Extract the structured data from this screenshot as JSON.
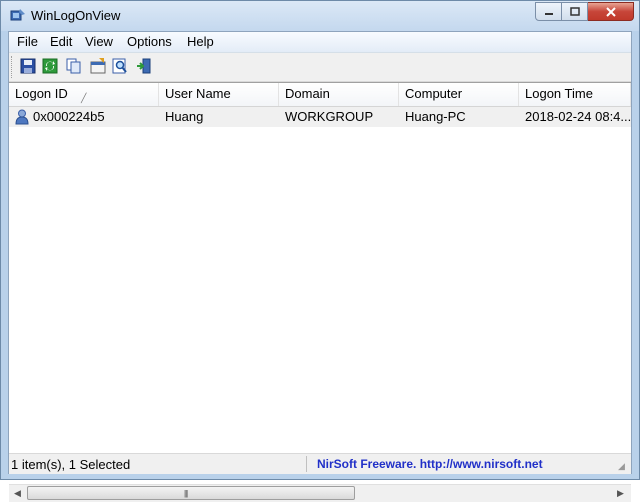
{
  "window": {
    "title": "WinLogOnView"
  },
  "menu": [
    "File",
    "Edit",
    "View",
    "Options",
    "Help"
  ],
  "toolbar": {
    "icons": [
      "save-icon",
      "refresh-icon",
      "copy-icon",
      "properties-icon",
      "find-icon",
      "exit-icon"
    ]
  },
  "table": {
    "columns": [
      "Logon ID",
      "User Name",
      "Domain",
      "Computer",
      "Logon Time"
    ],
    "rows": [
      {
        "logon_id": "0x000224b5",
        "user_name": "Huang",
        "domain": "WORKGROUP",
        "computer": "Huang-PC",
        "logon_time": "2018-02-24 08:4..."
      }
    ]
  },
  "status": {
    "items": "1 item(s), 1 Selected",
    "link": "NirSoft Freeware.  http://www.nirsoft.net"
  },
  "colors": {
    "link": "#2130c8",
    "close_button": "#c7463a"
  }
}
